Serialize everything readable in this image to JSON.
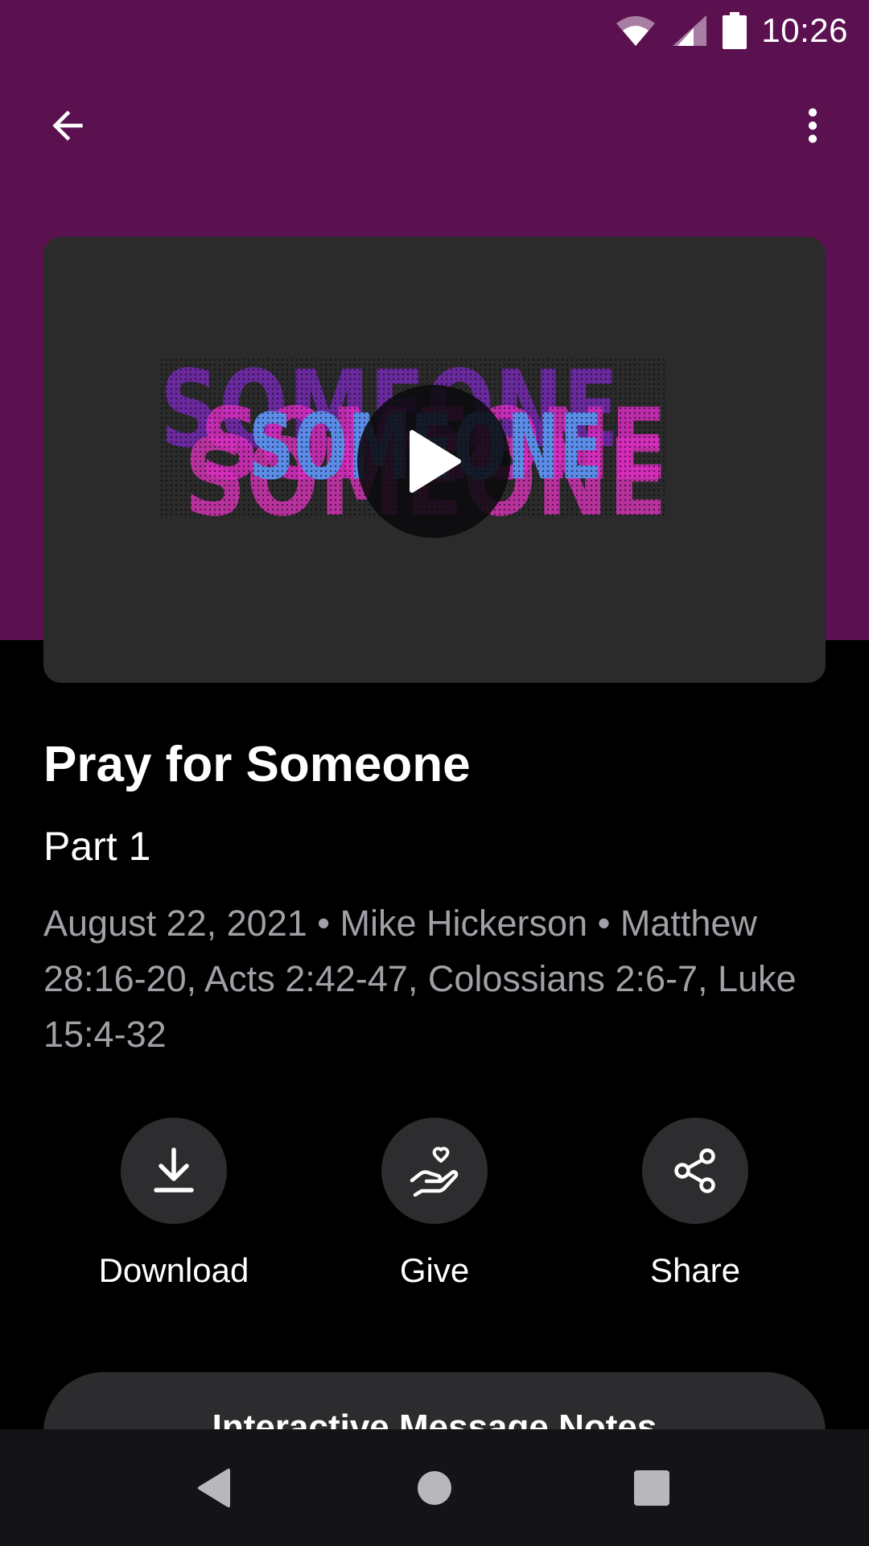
{
  "status_bar": {
    "time": "10:26",
    "icons": [
      "wifi-icon",
      "cell-signal-icon",
      "battery-icon"
    ]
  },
  "app_bar": {
    "back_icon": "arrow-left-icon",
    "menu_icon": "more-vertical-icon"
  },
  "media": {
    "artwork_text": "SOMEONE",
    "play_icon": "play-icon"
  },
  "sermon": {
    "title": "Pray for Someone",
    "subtitle": "Part 1",
    "meta": "August 22, 2021 • Mike Hickerson • Matthew 28:16-20, Acts 2:42-47, Colossians 2:6-7, Luke 15:4-32"
  },
  "actions": [
    {
      "label": "Download",
      "icon": "download-icon"
    },
    {
      "label": "Give",
      "icon": "hand-heart-icon"
    },
    {
      "label": "Share",
      "icon": "share-icon"
    }
  ],
  "notes_button": {
    "label": "Interactive Message Notes"
  },
  "nav_bar": {
    "icons": [
      "nav-back-icon",
      "nav-home-icon",
      "nav-recents-icon"
    ]
  },
  "colors": {
    "header_purple": "#5b1150",
    "card_bg": "#2b2b2b",
    "meta_gray": "#a0a0a6",
    "artwork_purple": "#6a2a9e",
    "artwork_blue": "#5b8ce8",
    "artwork_pink": "#d82dc0"
  }
}
